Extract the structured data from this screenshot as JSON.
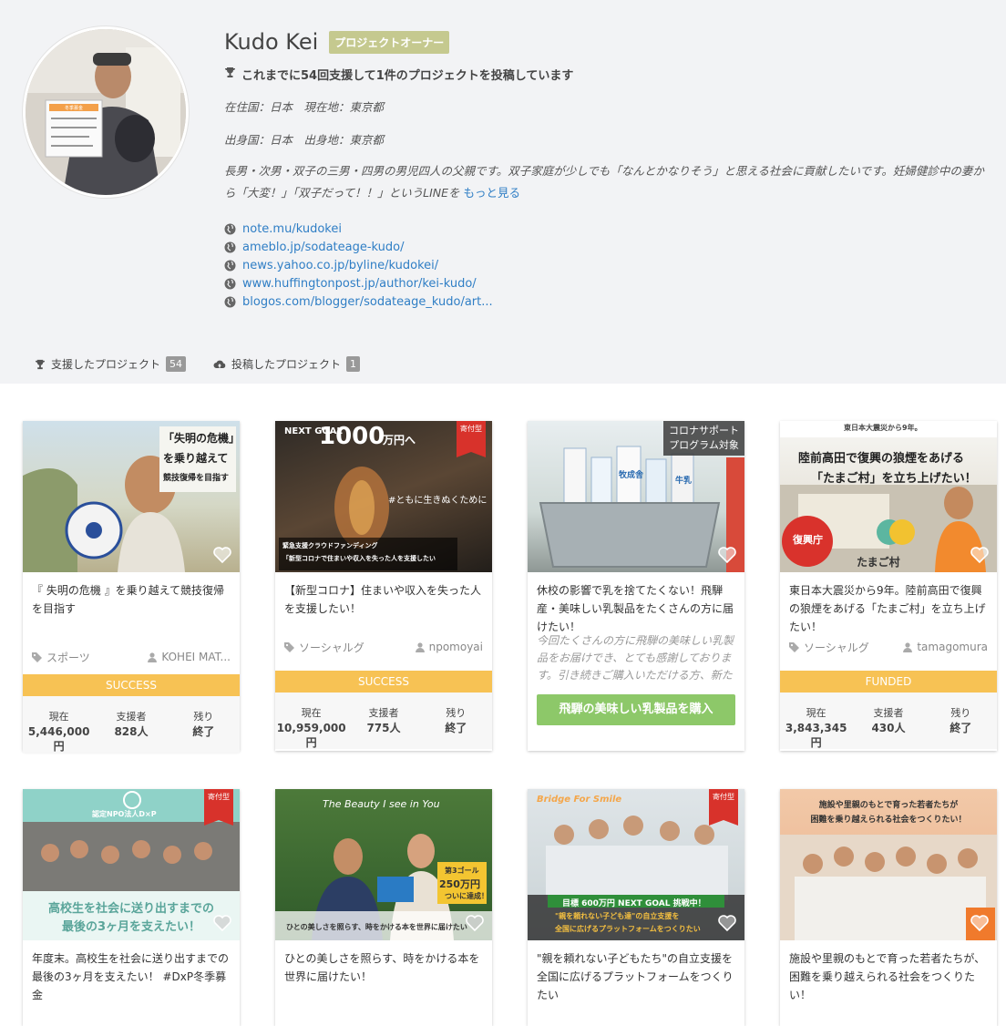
{
  "profile": {
    "name": "Kudo Kei",
    "badge": "プロジェクトオーナー",
    "support_line": "これまでに54回支援して1件のプロジェクトを投稿しています",
    "residence": "在住国：日本　現在地：東京都",
    "birthplace": "出身国：日本　出身地：東京都",
    "bio": "長男・次男・双子の三男・四男の男児四人の父親です。双子家庭が少しでも「なんとかなりそう」と思える社会に貢献したいです。妊婦健診中の妻から「大変！」「双子だって！！」というLINEを",
    "more_link": "もっと見る",
    "links": [
      "note.mu/kudokei",
      "ameblo.jp/sodateage-kudo/",
      "news.yahoo.co.jp/byline/kudokei/",
      "www.huffingtonpost.jp/author/kei-kudo/",
      "blogos.com/blogger/sodateage_kudo/art..."
    ],
    "avatar_sign": "冬季募金"
  },
  "tabs": [
    {
      "label": "支援したプロジェクト",
      "count": "54",
      "icon": "trophy-icon"
    },
    {
      "label": "投稿したプロジェクト",
      "count": "1",
      "icon": "cloud-upload-icon"
    }
  ],
  "cards": [
    {
      "thumb_texts": [
        "「失明の危機」",
        "を乗り越えて",
        "競技復帰を目指す"
      ],
      "title": "『 失明の危機 』を乗り越えて競技復帰を目指す",
      "tag": "スポーツ",
      "owner": "KOHEI MAT...",
      "status": "SUCCESS",
      "stats": [
        {
          "label": "現在",
          "value": "5,446,000円"
        },
        {
          "label": "支援者",
          "value": "828人"
        },
        {
          "label": "残り",
          "value": "終了"
        }
      ]
    },
    {
      "thumb_texts": [
        "NEXT GOAL",
        "1000",
        "万円へ",
        "#ともに生きぬくために",
        "緊急支援クラウドファンディング",
        "「新型コロナで住まいや収入を失った人を支援したい"
      ],
      "ribbon": "寄付型",
      "title": "【新型コロナ】住まいや収入を失った人を支援したい！",
      "tag": "ソーシャルグ",
      "owner": "npomoyai",
      "status": "SUCCESS",
      "stats": [
        {
          "label": "現在",
          "value": "10,959,000円"
        },
        {
          "label": "支援者",
          "value": "775人"
        },
        {
          "label": "残り",
          "value": "終了"
        }
      ]
    },
    {
      "thumb_texts": [
        "牧成舎",
        "牛乳"
      ],
      "corona": "コロナサポート\nプログラム対象",
      "title": "休校の影響で乳を捨てたくない！飛騨産・美味しい乳製品をたくさんの方に届けたい！",
      "desc": "今回たくさんの方に飛騨の美味しい乳製品をお届けでき、とても感謝しております。引き続きご購入いただける方、新たにご購入を検討いただける方、是非弊社のオンラ",
      "buy": "飛騨の美味しい乳製品を購入"
    },
    {
      "thumb_texts": [
        "東日本大震災から9年。",
        "陸前高田で復興の狼煙をあげる",
        "「たまご村」を立ち上げたい！",
        "復興庁",
        "たまご村"
      ],
      "title": "東日本大震災から9年。陸前高田で復興の狼煙をあげる「たまご村」を立ち上げたい！",
      "tag": "ソーシャルグ",
      "owner": "tamagomura",
      "status": "FUNDED",
      "stats": [
        {
          "label": "現在",
          "value": "3,843,345円"
        },
        {
          "label": "支援者",
          "value": "430人"
        },
        {
          "label": "残り",
          "value": "終了"
        }
      ]
    },
    {
      "thumb_texts": [
        "認定NPO法人D×P",
        "高校生を社会に送り出すまでの",
        "最後の3ヶ月を支えたい！"
      ],
      "ribbon": "寄付型",
      "title": "年度末。高校生を社会に送り出すまでの最後の3ヶ月を支えたい！ #DxP冬季募金"
    },
    {
      "thumb_texts": [
        "The Beauty I see in You",
        "ひとの美しさを照らす、時をかける本を世界に届けたい",
        "第3ゴール",
        "250万円",
        "ついに達成！"
      ],
      "title": "ひとの美しさを照らす、時をかける本を世界に届けたい！"
    },
    {
      "thumb_texts": [
        "Bridge For Smile",
        "目標 600万円 NEXT GOAL 挑戦中！",
        "\"親を頼れない子ども達\"の自立支援を",
        "全国に広げるプラットフォームをつくりたい"
      ],
      "ribbon": "寄付型",
      "title": "\"親を頼れない子どもたち\"の自立支援を全国に広げるプラットフォームをつくりたい"
    },
    {
      "thumb_texts": [
        "施設や里親のもとで育った若者たちが",
        "困難を乗り越えられる社会をつくりたい！"
      ],
      "title": "施設や里親のもとで育った若者たちが、困難を乗り越えられる社会をつくりたい！"
    }
  ],
  "colors": {
    "success": "#f7c254",
    "link": "#2f7ec5",
    "buy": "#8dc869",
    "ribbon": "#d8322b",
    "badge": "#c5c98f"
  }
}
